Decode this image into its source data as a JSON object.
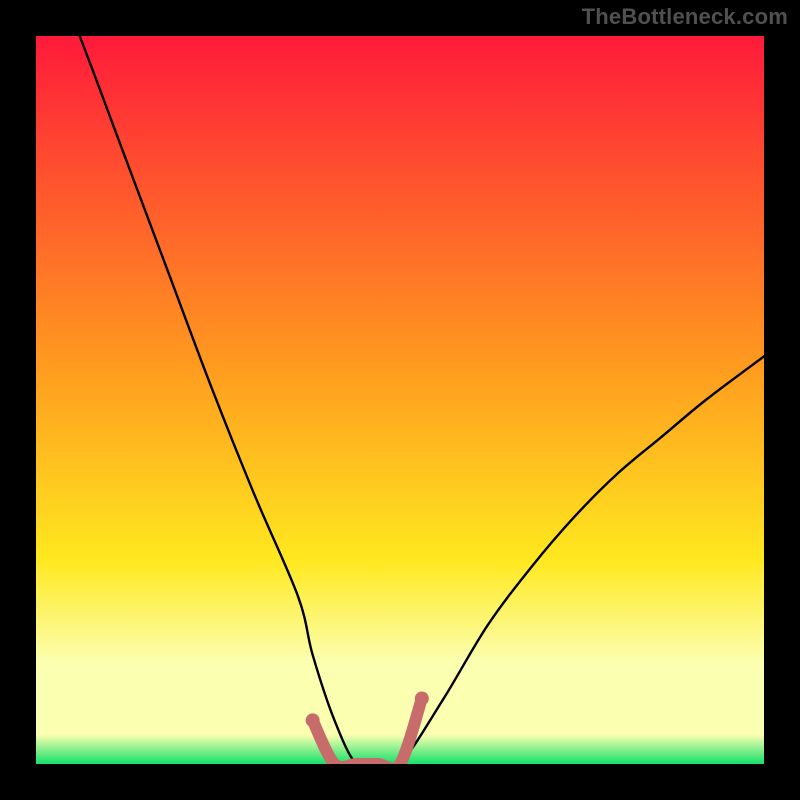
{
  "watermark": {
    "text": "TheBottleneck.com"
  },
  "colors": {
    "frame": "#000000",
    "gradient_top": "#ff1a3a",
    "gradient_mid1": "#ff9a1f",
    "gradient_mid2": "#ffe81f",
    "gradient_band": "#fbffb0",
    "gradient_green": "#14e06a",
    "curve": "#000000",
    "accent": "#c86b6b"
  },
  "chart_data": {
    "type": "line",
    "title": "",
    "xlabel": "",
    "ylabel": "",
    "xlim": [
      0,
      100
    ],
    "ylim": [
      0,
      100
    ],
    "series": [
      {
        "name": "bottleneck-curve",
        "x": [
          0,
          6,
          12,
          18,
          24,
          30,
          36,
          38,
          41,
          44,
          47,
          50,
          56,
          62,
          68,
          74,
          80,
          86,
          92,
          100
        ],
        "values": [
          115,
          100,
          84,
          68,
          52,
          37,
          23,
          15,
          6,
          0,
          0,
          0,
          9,
          19,
          27,
          34,
          40,
          45,
          50,
          56
        ]
      },
      {
        "name": "accent-valley",
        "x": [
          38,
          41,
          44,
          47,
          50,
          53
        ],
        "values": [
          6,
          0,
          0,
          0,
          0,
          9
        ]
      }
    ],
    "accent_points": {
      "x": [
        38,
        53
      ],
      "values": [
        6,
        9
      ]
    }
  }
}
